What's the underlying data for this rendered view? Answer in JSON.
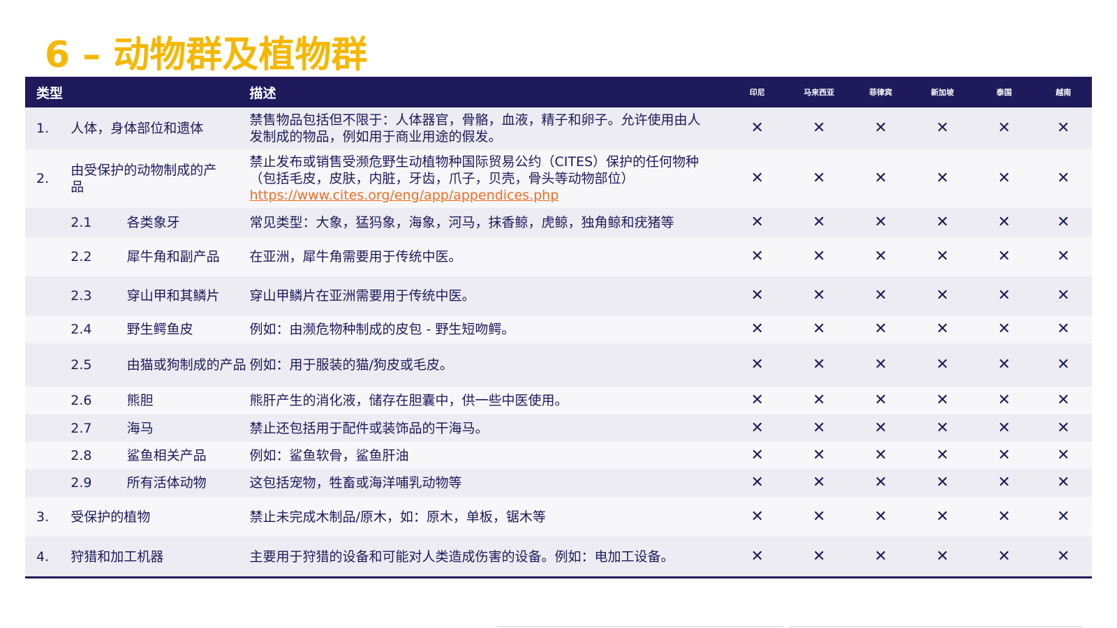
{
  "title": "6 – 动物群及植物群",
  "headers": {
    "type": "类型",
    "description": "描述",
    "countries": [
      "印尼",
      "马来西亚",
      "菲律宾",
      "新加坡",
      "泰国",
      "越南"
    ]
  },
  "mark": "✕",
  "rows": [
    {
      "num": "1.",
      "cat": "人体，身体部位和遗体",
      "desc": "禁售物品包括但不限于：人体器官，骨骼，血液，精子和卵子。允许使用由人发制成的物品，例如用于商业用途的假发。",
      "sub": false,
      "h": 60
    },
    {
      "num": "2.",
      "cat": "由受保护的动物制成的产品",
      "desc": "禁止发布或销售受濒危野生动植物种国际贸易公约（CITES）保护的任何物种（包括毛皮，皮肤，内脏，牙齿，爪子，贝壳，骨头等动物部位）",
      "link": "https://www.cites.org/eng/app/appendices.php",
      "sub": false,
      "h": 84
    },
    {
      "num": "2.1",
      "cat": "各类象牙",
      "desc": "常见类型：大象，猛犸象，海象，河马，抹香鲸，虎鲸，独角鲸和疣猪等",
      "sub": true,
      "h": 42
    },
    {
      "num": "2.2",
      "cat": "犀牛角和副产品",
      "desc": "在亚洲，犀牛角需要用于传统中医。",
      "sub": true,
      "h": 56
    },
    {
      "num": "2.3",
      "cat": "穿山甲和其鳞片",
      "desc": "穿山甲鳞片在亚洲需要用于传统中医。",
      "sub": true,
      "h": 56
    },
    {
      "num": "2.4",
      "cat": "野生鳄鱼皮",
      "desc": "例如：由濒危物种制成的皮包 - 野生短吻鳄。",
      "sub": true,
      "h": 40
    },
    {
      "num": "2.5",
      "cat": "由猫或狗制成的产品",
      "desc": "例如：用于服装的猫/狗皮或毛皮。",
      "sub": true,
      "h": 62
    },
    {
      "num": "2.6",
      "cat": "熊胆",
      "desc": "熊肝产生的消化液，储存在胆囊中，供一些中医使用。",
      "sub": true,
      "h": 40
    },
    {
      "num": "2.7",
      "cat": "海马",
      "desc": "禁止还包括用于配件或装饰品的干海马。",
      "sub": true,
      "h": 39
    },
    {
      "num": "2.8",
      "cat": "鲨鱼相关产品",
      "desc": "例如：鲨鱼软骨，鲨鱼肝油",
      "sub": true,
      "h": 39
    },
    {
      "num": "2.9",
      "cat": "所有活体动物",
      "desc": "这包括宠物，牲畜或海洋哺乳动物等",
      "sub": true,
      "h": 40
    },
    {
      "num": "3.",
      "cat": "受保护的植物",
      "desc": "禁止未完成木制品/原木，如：原木，单板，锯木等",
      "sub": false,
      "h": 57
    },
    {
      "num": "4.",
      "cat": "狩猎和加工机器",
      "desc": "主要用于狩猎的设备和可能对人类造成伤害的设备。例如：电加工设备。",
      "sub": false,
      "h": 57
    }
  ]
}
